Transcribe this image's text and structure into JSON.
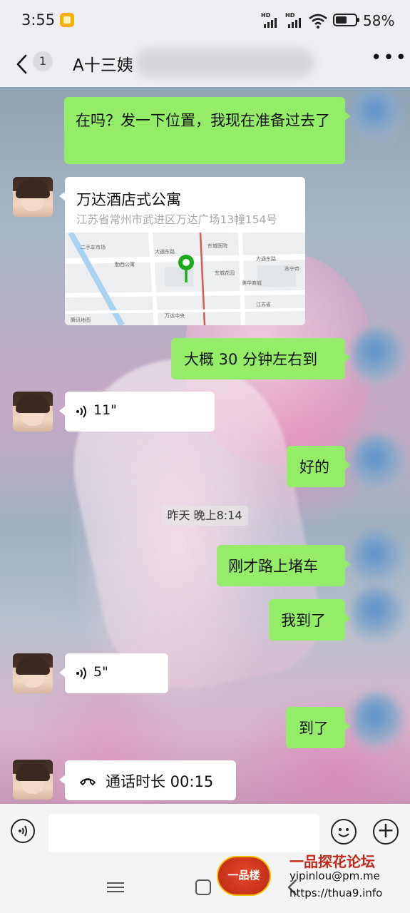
{
  "status_bar": {
    "time": "3:55",
    "battery": "58%",
    "battery_level": 0.58
  },
  "header": {
    "unread_count": "1",
    "title": "A十三姨"
  },
  "messages": [
    {
      "id": "m1",
      "side": "right",
      "type": "text",
      "text": "在吗？发一下位置，我现在准备过去了"
    },
    {
      "id": "m2",
      "side": "left",
      "type": "location",
      "title": "万达酒店式公寓",
      "address": "江苏省常州市武进区万达广场13幢154号"
    },
    {
      "id": "m3",
      "side": "right",
      "type": "text",
      "text": "大概 30 分钟左右到"
    },
    {
      "id": "m4",
      "side": "left",
      "type": "voice",
      "duration": "11\""
    },
    {
      "id": "m5",
      "side": "right",
      "type": "text",
      "text": "好的"
    },
    {
      "id": "m6",
      "side": "right",
      "type": "text",
      "text": "刚才路上堵车"
    },
    {
      "id": "m7",
      "side": "right",
      "type": "text",
      "text": "我到了"
    },
    {
      "id": "m8",
      "side": "left",
      "type": "voice",
      "duration": "5\""
    },
    {
      "id": "m9",
      "side": "right",
      "type": "text",
      "text": "到了"
    },
    {
      "id": "m10",
      "side": "left",
      "type": "call",
      "text": "通话时长 00:15"
    }
  ],
  "timestamp": "昨天 晚上8:14",
  "map_labels": [
    "二手车市场",
    "大通东路",
    "勤西公寓",
    "东城医院",
    "东城花园",
    "腾讯地图",
    "万达中央",
    "大通东路",
    "苏宁帝",
    "美华商城",
    "江苏省"
  ],
  "watermark": {
    "logo_text": "一品楼",
    "title": "一品探花论坛",
    "email": "yipinlou@pm.me",
    "url": "https://thua9.info"
  },
  "colors": {
    "bubble_green": "#95ec69",
    "map_pin": "#1aad19",
    "watermark_red": "#c0281a"
  }
}
